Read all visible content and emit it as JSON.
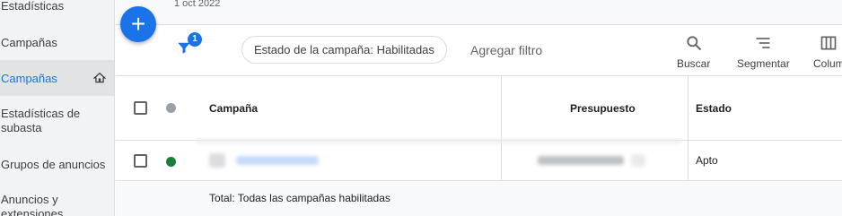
{
  "sidebar": {
    "items": [
      {
        "label": "Estadísticas",
        "active": false
      },
      {
        "label": "Campañas",
        "active": false
      },
      {
        "label": "Campañas",
        "active": true
      },
      {
        "label": "Estadísticas de subasta",
        "active": false
      },
      {
        "label": "Grupos de anuncios",
        "active": false
      },
      {
        "label": "Anuncios y extensiones",
        "active": false
      }
    ]
  },
  "header": {
    "date": "1 oct 2022"
  },
  "toolbar": {
    "add_icon": "plus-icon",
    "filter_count": "1",
    "filter_chip": "Estado de la campaña: Habilitadas",
    "add_filter": "Agregar filtro",
    "search_label": "Buscar",
    "segment_label": "Segmentar",
    "columns_label": "Colum"
  },
  "table": {
    "headers": {
      "campaign": "Campaña",
      "budget": "Presupuesto",
      "status": "Estado"
    },
    "rows": [
      {
        "status": "Apto",
        "status_color": "#188038"
      }
    ],
    "total_label": "Total: Todas las campañas habilitadas"
  },
  "colors": {
    "accent": "#1a73e8",
    "enabled": "#188038",
    "header_dot": "#9aa0a6"
  }
}
